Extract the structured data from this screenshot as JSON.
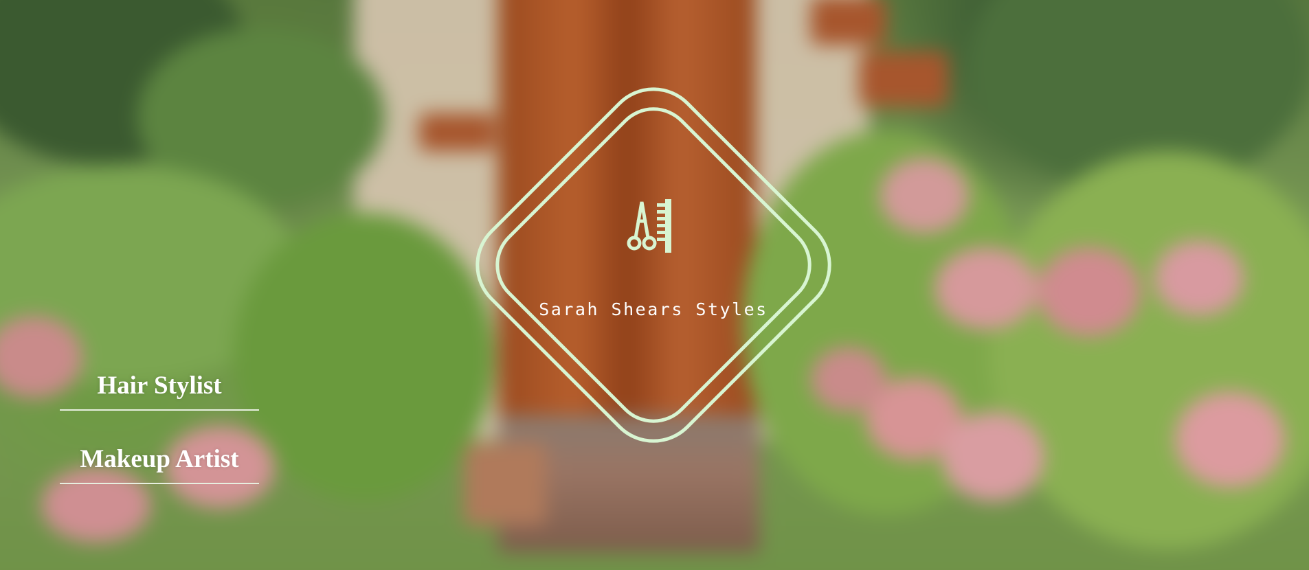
{
  "brand": {
    "name": "Sarah Shears Styles",
    "icon": "scissors-comb-icon",
    "accent_color": "#d8f5d2"
  },
  "services": [
    {
      "label": "Hair Stylist"
    },
    {
      "label": "Makeup Artist"
    }
  ]
}
